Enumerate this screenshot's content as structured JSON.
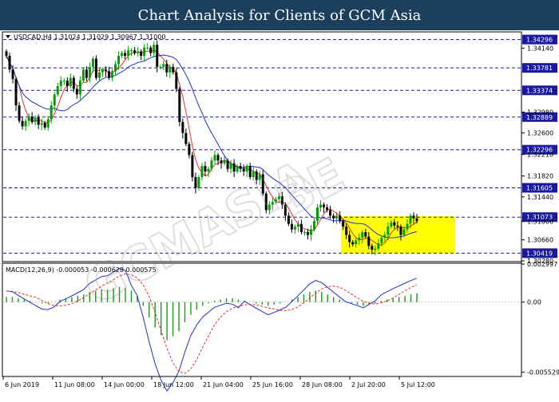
{
  "header": {
    "title": "Chart Analysis for Clients of GCM Asia"
  },
  "chart_data": {
    "type": "candlestick",
    "symbol_line": "USDCAD,H4  1.31024 1.31029 1.30967 1.31000",
    "price_ylim": [
      1.3028,
      1.3442
    ],
    "price_ticks": [
      "1.34140",
      "1.32980",
      "1.32600",
      "1.32210",
      "1.31820",
      "1.31440",
      "1.31000",
      "1.30660",
      "1.30280"
    ],
    "levels": [
      {
        "label": "1.34296",
        "value": 1.34296
      },
      {
        "label": "1.33781",
        "value": 1.33781
      },
      {
        "label": "1.33374",
        "value": 1.33374
      },
      {
        "label": "1.32889",
        "value": 1.32889
      },
      {
        "label": "1.32296",
        "value": 1.32296
      },
      {
        "label": "1.31605",
        "value": 1.31605
      },
      {
        "label": "1.31073",
        "value": 1.31073
      },
      {
        "label": "1.30419",
        "value": 1.30419
      }
    ],
    "x_labels": [
      "6 Jun 2019",
      "11 Jun 08:00",
      "14 Jun 00:00",
      "18 Jun 12:00",
      "21 Jun 04:00",
      "25 Jun 16:00",
      "28 Jun 08:00",
      "2 Jul 20:00",
      "5 Jul 12:00"
    ],
    "macd_label": "MACD(12,26,9) -0.000053 -0.000628 0.000575",
    "macd_ylim": [
      -0.0058,
      0.003
    ],
    "macd_ticks": [
      "0.002997",
      "0.00",
      "-0.005529"
    ],
    "colors": {
      "up": "#00a000",
      "down": "#000000",
      "ma_fast": "#e03030",
      "ma_slow": "#2030d0",
      "level_line": "#1a1aa0",
      "highlight": "#ffff00",
      "hist": "#1a9a1a",
      "macd_line": "#2030d0",
      "signal_line": "#e03030",
      "level_box": "#1a1aa0"
    },
    "closes": [
      1.34,
      1.3375,
      1.3358,
      1.331,
      1.3282,
      1.3272,
      1.3282,
      1.329,
      1.328,
      1.3288,
      1.3275,
      1.3278,
      1.327,
      1.3285,
      1.331,
      1.333,
      1.3345,
      1.3355,
      1.3355,
      1.3345,
      1.336,
      1.334,
      1.333,
      1.3355,
      1.3375,
      1.336,
      1.338,
      1.3395,
      1.336,
      1.337,
      1.3375,
      1.3372,
      1.336,
      1.3372,
      1.3385,
      1.34,
      1.3405,
      1.34,
      1.341,
      1.341,
      1.3405,
      1.3408,
      1.34,
      1.3415,
      1.3415,
      1.3405,
      1.342,
      1.338,
      1.338,
      1.3385,
      1.337,
      1.338,
      1.337,
      1.334,
      1.328,
      1.326,
      1.324,
      1.322,
      1.318,
      1.316,
      1.318,
      1.32,
      1.319,
      1.3195,
      1.321,
      1.322,
      1.321,
      1.3205,
      1.321,
      1.3195,
      1.3205,
      1.319,
      1.32,
      1.3195,
      1.319,
      1.32,
      1.318,
      1.319,
      1.3175,
      1.3185,
      1.315,
      1.312,
      1.313,
      1.3135,
      1.314,
      1.3145,
      1.313,
      1.311,
      1.3095,
      1.3085,
      1.309,
      1.3095,
      1.308,
      1.308,
      1.3075,
      1.3085,
      1.31,
      1.3125,
      1.313,
      1.3125,
      1.312,
      1.311,
      1.3105,
      1.311,
      1.31,
      1.309,
      1.3075,
      1.3062,
      1.3058,
      1.3065,
      1.307,
      1.308,
      1.3072,
      1.3055,
      1.3048,
      1.305,
      1.306,
      1.307,
      1.3075,
      1.309,
      1.3098,
      1.3092,
      1.309,
      1.3075,
      1.3085,
      1.3095,
      1.311,
      1.3105,
      1.31
    ],
    "macd_hist": [
      0.0004,
      0.0004,
      0.0003,
      0.0002,
      0.0001,
      0.0,
      -0.0001,
      -0.0001,
      0.0,
      0.0002,
      0.0003,
      0.0004,
      0.0005,
      0.0006,
      0.0008,
      0.0009,
      0.001,
      0.001,
      0.0011,
      0.0012,
      0.0011,
      0.0009,
      0.0005,
      -0.0003,
      -0.0012,
      -0.002,
      -0.0026,
      -0.003,
      -0.0027,
      -0.0023,
      -0.0016,
      -0.001,
      -0.0006,
      -0.0003,
      -0.0001,
      0.0001,
      0.0002,
      0.0003,
      0.0003,
      0.0002,
      0.0001,
      0.0,
      -0.0001,
      -0.0002,
      -0.0003,
      -0.0002,
      -0.0001,
      0.0,
      0.0002,
      0.0004,
      0.0006,
      0.0008,
      0.0009,
      0.0008,
      0.0006,
      0.0004,
      0.0002,
      0.0,
      -0.0001,
      -0.0002,
      -0.0003,
      -0.0002,
      -0.0001,
      0.0001,
      0.0002,
      0.0003,
      0.0004,
      0.0005,
      0.0006,
      0.0007
    ]
  }
}
